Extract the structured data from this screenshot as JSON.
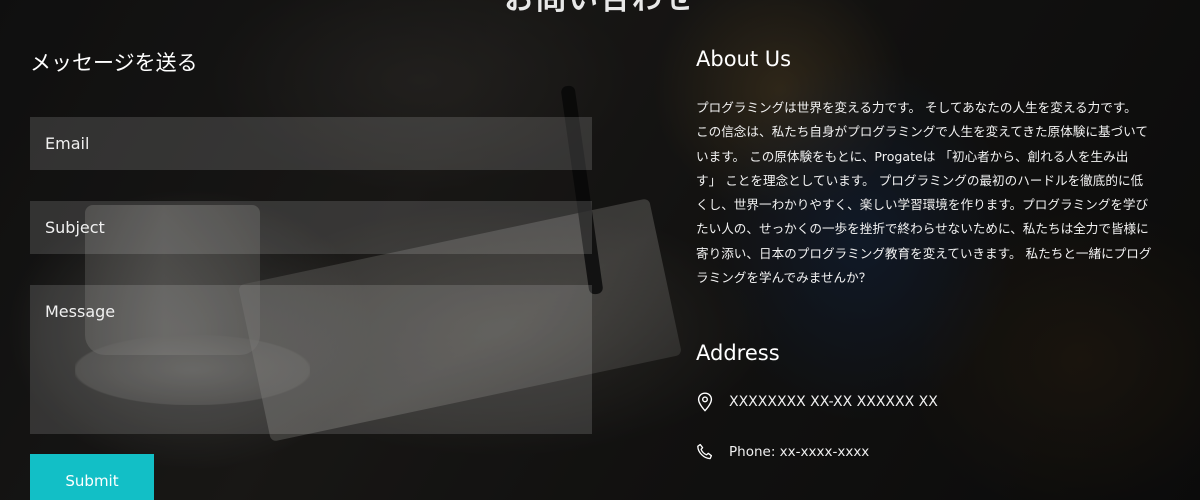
{
  "page_title": "お問い合わせ",
  "contact_form": {
    "heading": "メッセージを送る",
    "email_placeholder": "Email",
    "subject_placeholder": "Subject",
    "message_placeholder": "Message",
    "submit_label": "Submit",
    "submit_color": "#12bfc6"
  },
  "about": {
    "heading": "About Us",
    "text": "プログラミングは世界を変える力です。 そしてあなたの人生を変える力です。 この信念は、私たち自身がプログラミングで人生を変えてきた原体験に基づいています。 この原体験をもとに、Progateは 「初心者から、創れる人を生み出す」 ことを理念としています。 プログラミングの最初のハードルを徹底的に低くし、世界一わかりやすく、楽しい学習環境を作ります。プログラミングを学びたい人の、せっかくの一歩を挫折で終わらせないために、私たちは全力で皆様に寄り添い、日本のプログラミング教育を変えていきます。 私たちと一緒にプログラミングを学んでみませんか？"
  },
  "address": {
    "heading": "Address",
    "location": "XXXXXXXX XX-XX XXXXXX XX",
    "location_icon": "map-pin-icon",
    "phone": "Phone: xx-xxxx-xxxx",
    "phone_icon": "phone-icon"
  }
}
